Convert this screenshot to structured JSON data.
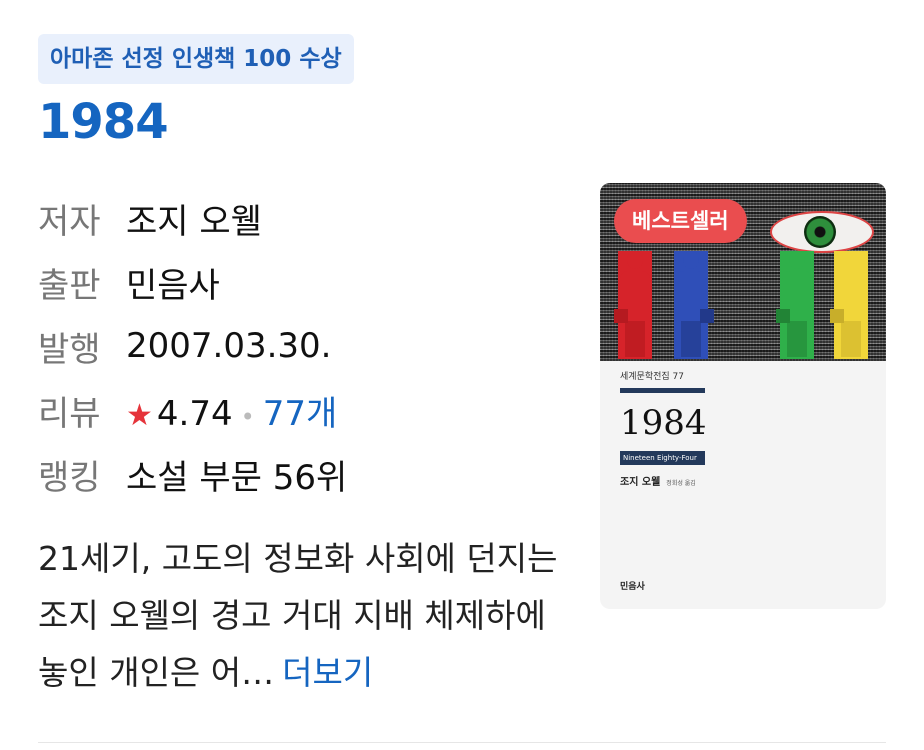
{
  "badge": "아마존 선정 인생책 100 수상",
  "title": "1984",
  "meta": {
    "author_label": "저자",
    "author": "조지 오웰",
    "publisher_label": "출판",
    "publisher": "민음사",
    "date_label": "발행",
    "date": "2007.03.30.",
    "review_label": "리뷰",
    "rating": "4.74",
    "review_count": "77개",
    "ranking_label": "랭킹",
    "ranking": "소설 부문 56위"
  },
  "description": "21세기, 고도의 정보화 사회에 던지는 조지 오웰의 경고 거대 지배 체제하에 놓인 개인은 어…",
  "more_label": "더보기",
  "cover": {
    "badge": "베스트셀러",
    "series": "세계문학전집 77",
    "title": "1984",
    "subtitle": "Nineteen Eighty-Four",
    "author": "조지 오웰",
    "translator": "정회성 옮김",
    "publisher": "민음사"
  },
  "colors": {
    "accent": "#1565c0",
    "badge_bg": "#e9f0fc",
    "cover_badge": "#ea4d4f",
    "star": "#e5343b"
  }
}
